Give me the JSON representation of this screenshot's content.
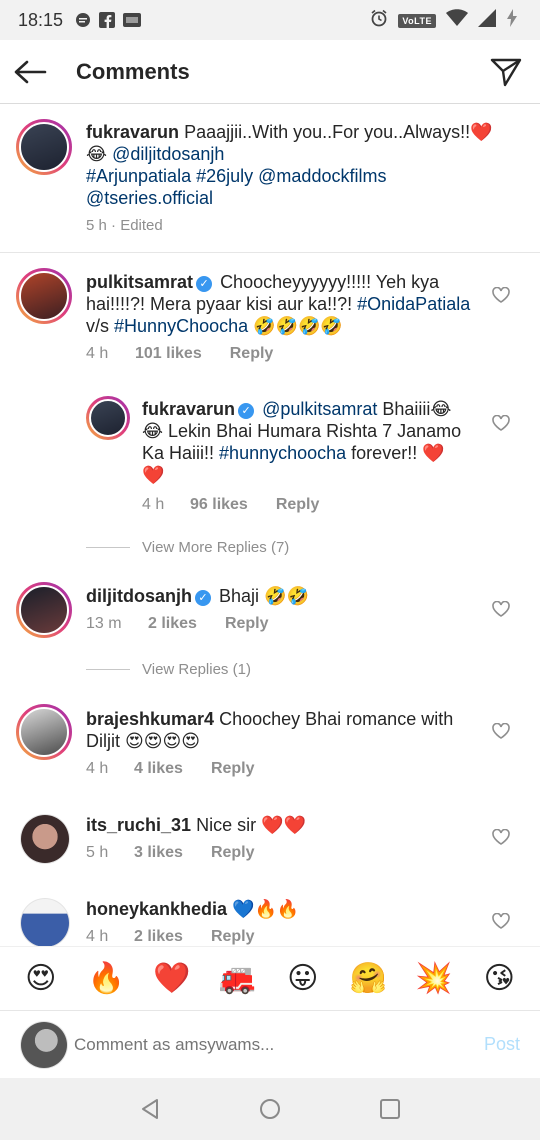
{
  "status_bar": {
    "time": "18:15",
    "volte": "VoLTE"
  },
  "header": {
    "title": "Comments"
  },
  "caption": {
    "username": "fukravarun",
    "text_1": "Paaajjii..With you..For you..Always!!",
    "emoji_1": "❤️",
    "emoji_2": "😂",
    "mention_1": "@diljitdosanjh",
    "hashtag_1": "#Arjunpatiala",
    "hashtag_2": "#26july",
    "mention_2": "@maddockfilms",
    "mention_3": "@tseries.official",
    "time": "5 h",
    "edited": "Edited"
  },
  "comments": [
    {
      "username": "pulkitsamrat",
      "text_1": "Choocheyyyyyy!!!!! Yeh kya hai!!!!?! Mera pyaar kisi aur ka!!?!",
      "hashtag_1": "#OnidaPatiala",
      "text_2": "v/s",
      "hashtag_2": "#HunnyChoocha",
      "emojis": "🤣🤣🤣🤣",
      "time": "4 h",
      "likes": "101 likes",
      "reply": "Reply"
    },
    {
      "username": "fukravarun",
      "mention": "@pulkitsamrat",
      "text_1": "Bhaiiii😂",
      "text_2": "😂 Lekin Bhai Humara Rishta 7 Janamo Ka Haiii!!",
      "hashtag": "#hunnychoocha",
      "text_3": "forever!! ❤️",
      "text_4": "❤️",
      "time": "4 h",
      "likes": "96 likes",
      "reply": "Reply"
    },
    {
      "username": "diljitdosanjh",
      "text_1": "Bhaji 🤣🤣",
      "time": "13 m",
      "likes": "2 likes",
      "reply": "Reply"
    },
    {
      "username": "brajeshkumar4",
      "text_1": "Choochey Bhai romance with Diljit 😍😍😍😍",
      "time": "4 h",
      "likes": "4 likes",
      "reply": "Reply"
    },
    {
      "username": "its_ruchi_31",
      "text_1": "Nice sir ❤️❤️",
      "time": "5 h",
      "likes": "3 likes",
      "reply": "Reply"
    },
    {
      "username": "honeykankhedia",
      "text_1": "💙🔥🔥",
      "time": "4 h",
      "likes": "2 likes",
      "reply": "Reply"
    }
  ],
  "view_more_replies": "View More Replies (7)",
  "view_replies": "View Replies (1)",
  "emoji_bar": [
    "😍",
    "🔥",
    "❤️",
    "🚒",
    "😛",
    "🤗",
    "💥",
    "😘"
  ],
  "comment_box": {
    "placeholder": "Comment as amsywams...",
    "post": "Post"
  }
}
